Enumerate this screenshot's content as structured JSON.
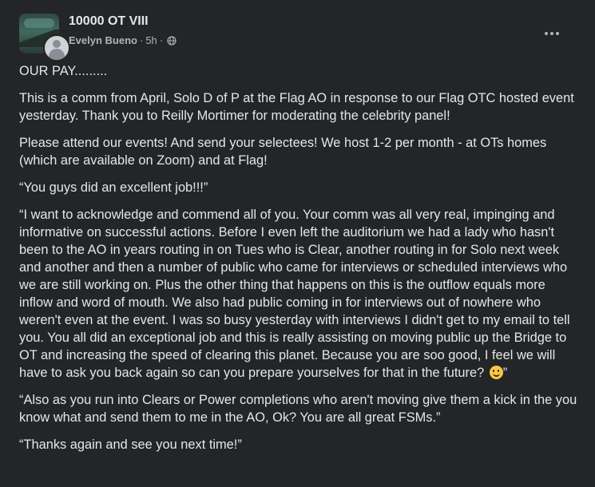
{
  "post": {
    "group_name": "10000 OT VIII",
    "author": "Evelyn Bueno",
    "separator": "·",
    "time": "5h",
    "separator2": "·",
    "privacy_icon": "globe-icon",
    "more_icon": "more-horizontal-icon",
    "emoji_icon": "slightly-smiling-face",
    "paragraphs": [
      "OUR PAY.........",
      "This is a comm from April, Solo D of P at the Flag AO in response to our Flag OTC hosted event yesterday. Thank you to Reilly Mortimer for moderating the celebrity panel!",
      "Please attend our events! And send your selectees! We host 1-2 per month - at OTs homes (which are available on Zoom) and at Flag!",
      "“You guys did an excellent job!!!”",
      "“I want to acknowledge and commend all of you. Your comm was all very real, impinging and informative on successful actions. Before I even left the auditorium we had a lady who hasn't been to the AO in years routing in on Tues who is Clear, another routing in for Solo next week and another and then a number of public who came for interviews or scheduled interviews who we are still working on. Plus the other thing that happens on this is the outflow equals more inflow and word of mouth. We also had public coming in for interviews out of nowhere who weren't even at the event. I was so busy yesterday with interviews I didn't get to my email to tell you. You all did an exceptional job and this is really assisting on moving public up the Bridge to OT and increasing the speed of clearing this planet. Because you are soo good, I feel we will have to ask you back again so can you prepare yourselves for that in the future?",
      "”",
      "“Also as you run into Clears or Power completions who aren't moving give them a kick in the you know what and send them to me in the AO, Ok? You are all great FSMs.”",
      "“Thanks again and see you next time!”"
    ]
  }
}
